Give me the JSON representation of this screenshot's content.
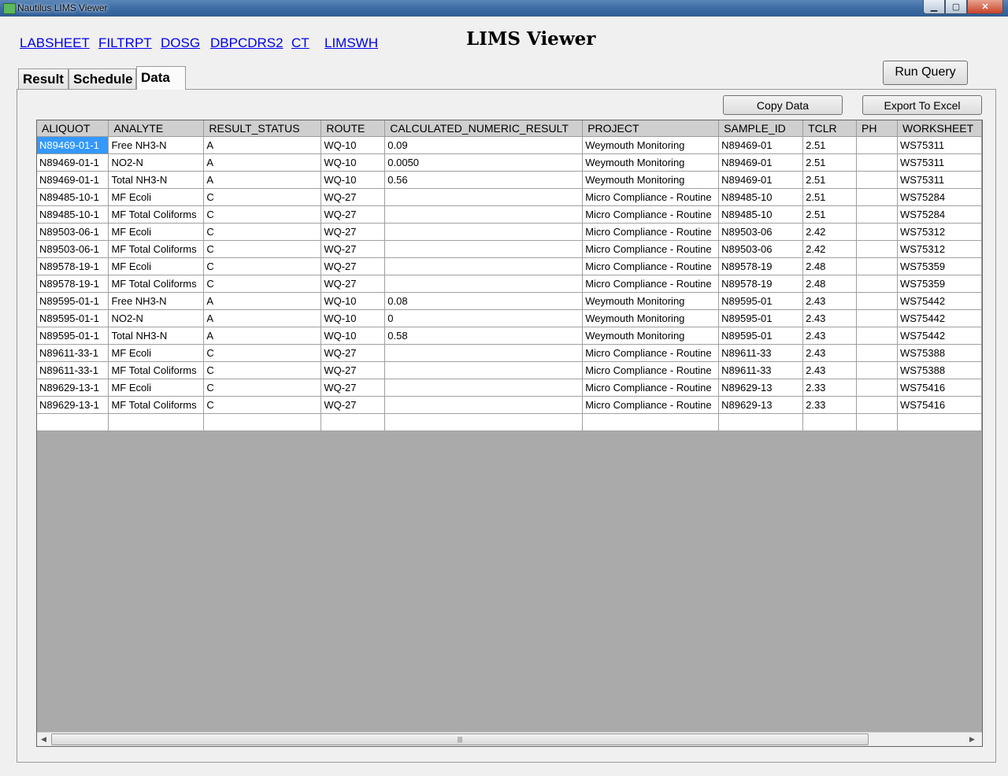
{
  "window": {
    "title": "Nautilus LIMS Viewer",
    "buttons": {
      "minimize": "▁",
      "maximize": "▢",
      "close": "✕"
    }
  },
  "links": [
    "LABSHEET",
    "FILTRPT",
    "DOSG",
    "DBPCDRS2",
    "CT",
    "LIMSWH"
  ],
  "page_title": "LIMS Viewer",
  "run_query_label": "Run Query",
  "tabs": [
    {
      "label": "Result",
      "active": false
    },
    {
      "label": "Schedule",
      "active": false
    },
    {
      "label": "Data",
      "active": true
    }
  ],
  "toolbar": {
    "copy_label": "Copy Data",
    "export_label": "Export To Excel"
  },
  "table": {
    "columns": [
      "ALIQUOT",
      "ANALYTE",
      "RESULT_STATUS",
      "ROUTE",
      "CALCULATED_NUMERIC_RESULT",
      "PROJECT",
      "SAMPLE_ID",
      "TCLR",
      "PH",
      "WORKSHEET"
    ],
    "rows": [
      [
        "N89469-01-1",
        "Free NH3-N",
        "A",
        "WQ-10",
        "0.09",
        "Weymouth Monitoring",
        "N89469-01",
        "2.51",
        "",
        "WS75311"
      ],
      [
        "N89469-01-1",
        "NO2-N",
        "A",
        "WQ-10",
        "0.0050",
        "Weymouth Monitoring",
        "N89469-01",
        "2.51",
        "",
        "WS75311"
      ],
      [
        "N89469-01-1",
        "Total NH3-N",
        "A",
        "WQ-10",
        "0.56",
        "Weymouth Monitoring",
        "N89469-01",
        "2.51",
        "",
        "WS75311"
      ],
      [
        "N89485-10-1",
        "MF Ecoli",
        "C",
        "WQ-27",
        "",
        "Micro Compliance - Routine",
        "N89485-10",
        "2.51",
        "",
        "WS75284"
      ],
      [
        "N89485-10-1",
        "MF Total Coliforms",
        "C",
        "WQ-27",
        "",
        "Micro Compliance - Routine",
        "N89485-10",
        "2.51",
        "",
        "WS75284"
      ],
      [
        "N89503-06-1",
        "MF Ecoli",
        "C",
        "WQ-27",
        "",
        "Micro Compliance - Routine",
        "N89503-06",
        "2.42",
        "",
        "WS75312"
      ],
      [
        "N89503-06-1",
        "MF Total Coliforms",
        "C",
        "WQ-27",
        "",
        "Micro Compliance - Routine",
        "N89503-06",
        "2.42",
        "",
        "WS75312"
      ],
      [
        "N89578-19-1",
        "MF Ecoli",
        "C",
        "WQ-27",
        "",
        "Micro Compliance - Routine",
        "N89578-19",
        "2.48",
        "",
        "WS75359"
      ],
      [
        "N89578-19-1",
        "MF Total Coliforms",
        "C",
        "WQ-27",
        "",
        "Micro Compliance - Routine",
        "N89578-19",
        "2.48",
        "",
        "WS75359"
      ],
      [
        "N89595-01-1",
        "Free NH3-N",
        "A",
        "WQ-10",
        "0.08",
        "Weymouth Monitoring",
        "N89595-01",
        "2.43",
        "",
        "WS75442"
      ],
      [
        "N89595-01-1",
        "NO2-N",
        "A",
        "WQ-10",
        "0",
        "Weymouth Monitoring",
        "N89595-01",
        "2.43",
        "",
        "WS75442"
      ],
      [
        "N89595-01-1",
        "Total NH3-N",
        "A",
        "WQ-10",
        "0.58",
        "Weymouth Monitoring",
        "N89595-01",
        "2.43",
        "",
        "WS75442"
      ],
      [
        "N89611-33-1",
        "MF Ecoli",
        "C",
        "WQ-27",
        "",
        "Micro Compliance - Routine",
        "N89611-33",
        "2.43",
        "",
        "WS75388"
      ],
      [
        "N89611-33-1",
        "MF Total Coliforms",
        "C",
        "WQ-27",
        "",
        "Micro Compliance - Routine",
        "N89611-33",
        "2.43",
        "",
        "WS75388"
      ],
      [
        "N89629-13-1",
        "MF Ecoli",
        "C",
        "WQ-27",
        "",
        "Micro Compliance - Routine",
        "N89629-13",
        "2.33",
        "",
        "WS75416"
      ],
      [
        "N89629-13-1",
        "MF Total Coliforms",
        "C",
        "WQ-27",
        "",
        "Micro Compliance - Routine",
        "N89629-13",
        "2.33",
        "",
        "WS75416"
      ],
      [
        "",
        "",
        "",
        "",
        "",
        "",
        "",
        "",
        "",
        ""
      ]
    ],
    "selected_cell": "N89469-01-1"
  },
  "scrollbar": {
    "grip": "|||"
  }
}
